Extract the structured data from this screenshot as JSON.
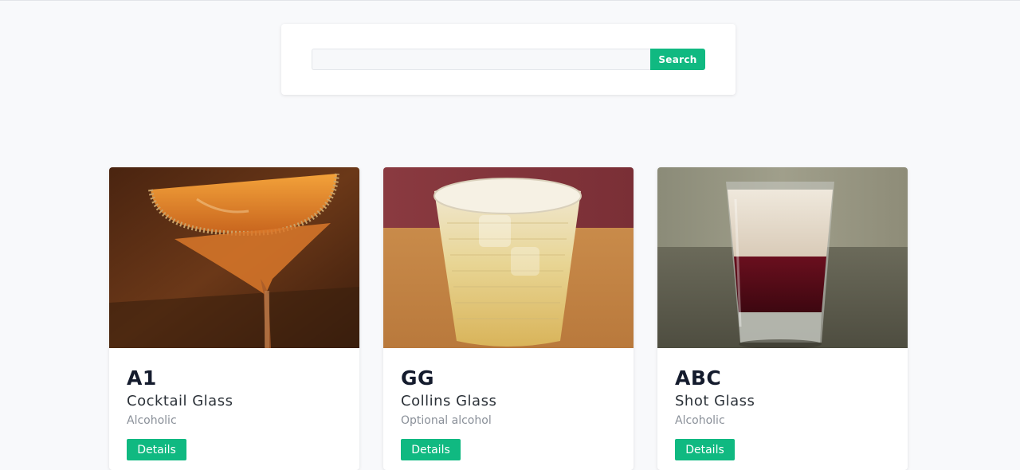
{
  "search": {
    "placeholder": "",
    "value": "",
    "button_label": "Search"
  },
  "cards": [
    {
      "title": "A1",
      "glass": "Cocktail Glass",
      "alcohol": "Alcoholic",
      "details_label": "Details",
      "image": "cocktail-glass-drink-photo"
    },
    {
      "title": "GG",
      "glass": "Collins Glass",
      "alcohol": "Optional alcohol",
      "details_label": "Details",
      "image": "collins-glass-drink-photo"
    },
    {
      "title": "ABC",
      "glass": "Shot Glass",
      "alcohol": "Alcoholic",
      "details_label": "Details",
      "image": "shot-glass-drink-photo"
    }
  ],
  "colors": {
    "accent": "#10b981",
    "background": "#f8f9fb",
    "card": "#ffffff",
    "title": "#141b2d",
    "muted": "#8a9099"
  }
}
